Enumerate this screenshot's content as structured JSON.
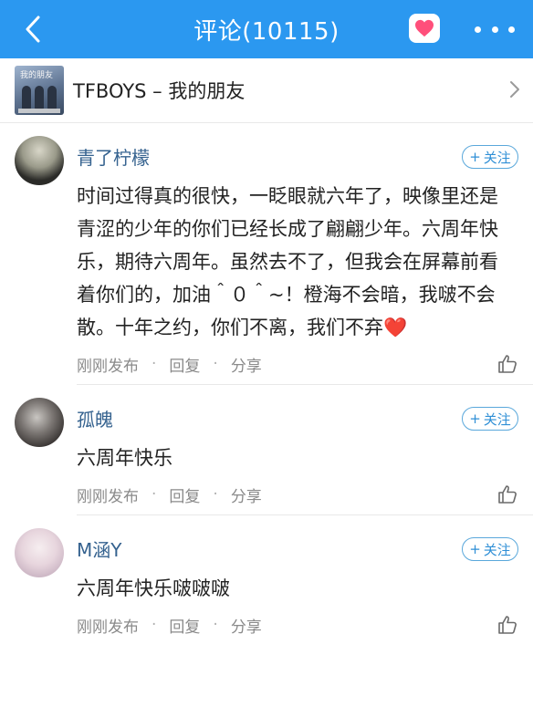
{
  "header": {
    "title": "评论(10115)"
  },
  "song": {
    "name": "TFBOYS – 我的朋友",
    "album_caption": "我的朋友"
  },
  "colors": {
    "header_bg": "#2b98f0",
    "username": "#35628f",
    "follow": "#2f8fd6",
    "heart": "#e53340"
  },
  "comments": [
    {
      "username": "青了柠檬",
      "follow_label": "关注",
      "text": "时间过得真的很快，一眨眼就六年了，映像里还是青涩的少年的你们已经长成了翩翩少年。六周年快乐，期待六周年。虽然去不了，但我会在屏幕前看着你们的，加油＾０＾~！橙海不会暗，我啵不会散。十年之约，你们不离，我们不弃",
      "emoji": "❤️",
      "time": "刚刚发布",
      "reply": "回复",
      "share": "分享"
    },
    {
      "username": "孤魄",
      "follow_label": "关注",
      "text": "六周年快乐",
      "time": "刚刚发布",
      "reply": "回复",
      "share": "分享"
    },
    {
      "username": "M涵Y",
      "follow_label": "关注",
      "text": "六周年快乐啵啵啵",
      "time": "刚刚发布",
      "reply": "回复",
      "share": "分享"
    }
  ]
}
